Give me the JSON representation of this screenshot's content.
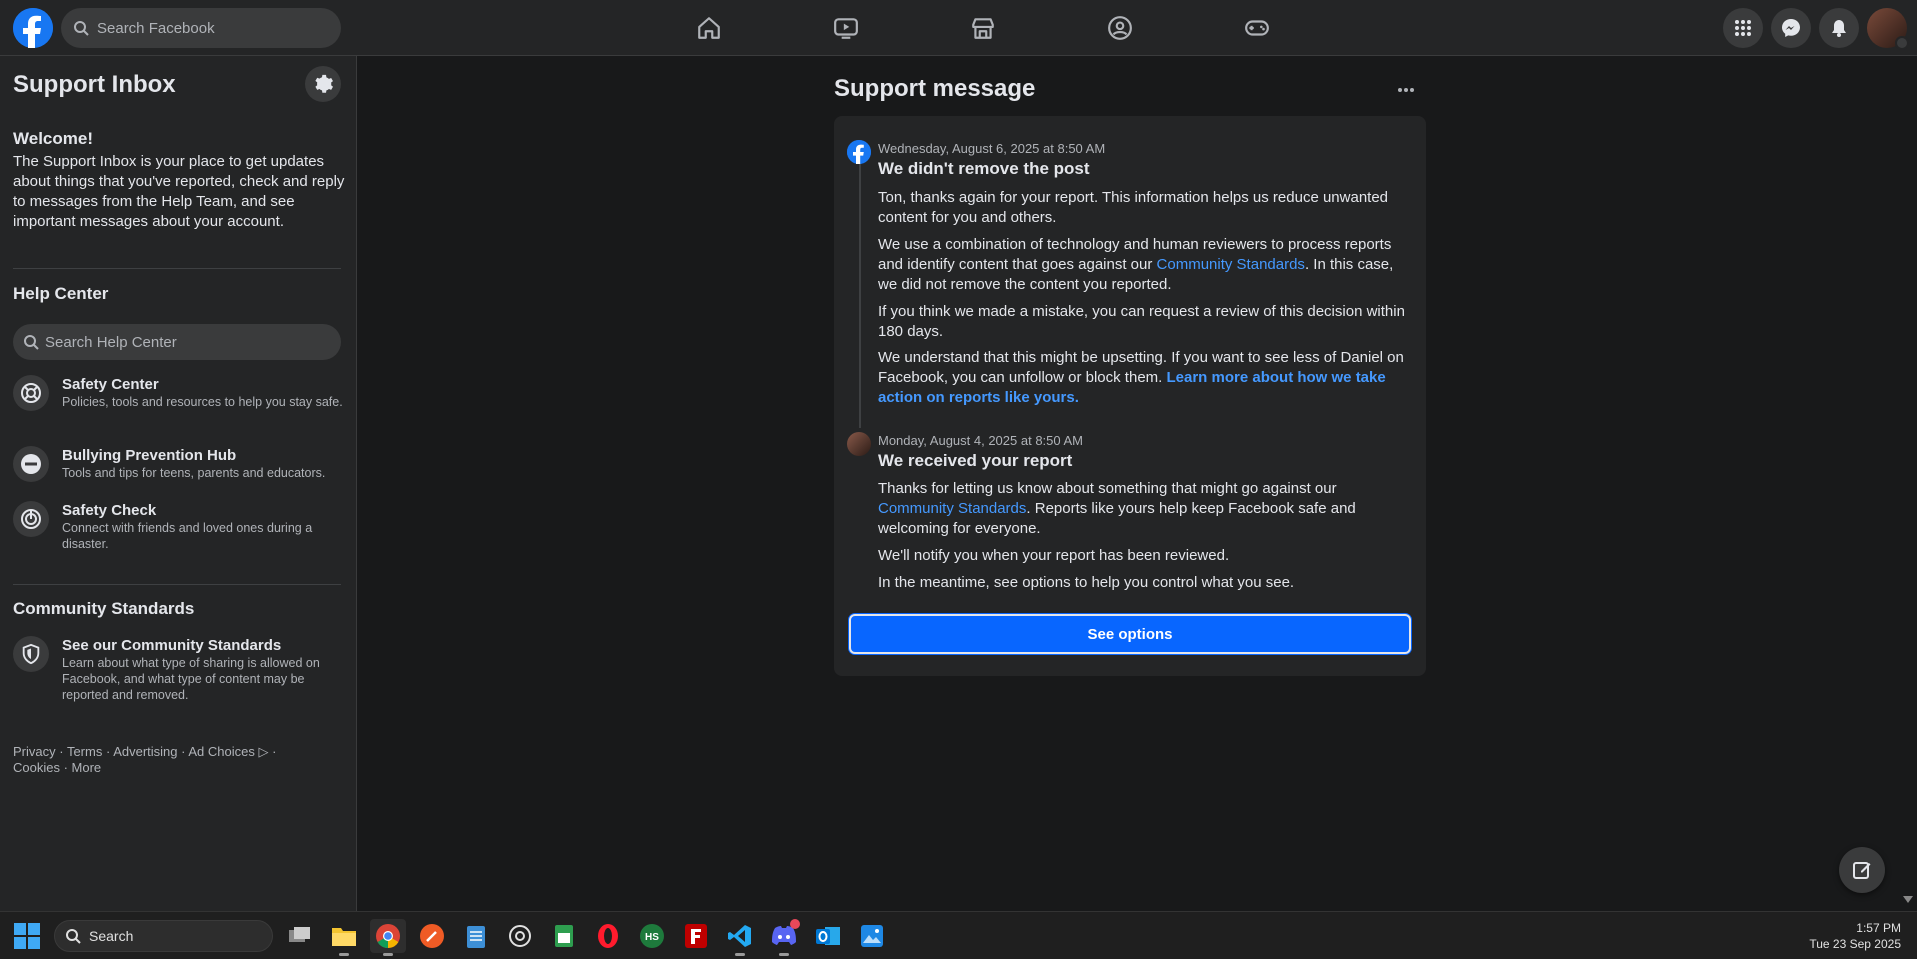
{
  "topbar": {
    "search_placeholder": "Search Facebook",
    "nav_items": [
      "home",
      "watch",
      "marketplace",
      "groups",
      "gaming"
    ]
  },
  "sidebar": {
    "title": "Support Inbox",
    "welcome_heading": "Welcome!",
    "welcome_text": "The Support Inbox is your place to get updates about things that you've reported, check and reply to messages from the Help Team, and see important messages about your account.",
    "help_center_heading": "Help Center",
    "help_search_placeholder": "Search Help Center",
    "help_items": [
      {
        "title": "Safety Center",
        "desc": "Policies, tools and resources to help you stay safe.",
        "icon": "lifebuoy-icon"
      },
      {
        "title": "Bullying Prevention Hub",
        "desc": "Tools and tips for teens, parents and educators.",
        "icon": "no-entry-icon"
      },
      {
        "title": "Safety Check",
        "desc": "Connect with friends and loved ones during a disaster.",
        "icon": "safety-check-icon"
      }
    ],
    "community_heading": "Community Standards",
    "community_item": {
      "title": "See our Community Standards",
      "desc": "Learn about what type of sharing is allowed on Facebook, and what type of content may be reported and removed."
    },
    "footer": {
      "privacy": "Privacy",
      "terms": "Terms",
      "advertising": "Advertising",
      "ad_choices": "Ad Choices",
      "cookies": "Cookies",
      "more": "More"
    }
  },
  "main": {
    "title": "Support message",
    "messages": [
      {
        "date": "Wednesday, August 6, 2025 at 8:50 AM",
        "title": "We didn't remove the post",
        "p1": "Ton, thanks again for your report. This information helps us reduce unwanted content for you and others.",
        "p2_before": "We use a combination of technology and human reviewers to process reports and identify content that goes against our ",
        "p2_link": "Community Standards",
        "p2_after": ". In this case, we did not remove the content you reported.",
        "p3": "If you think we made a mistake, you can request a review of this decision within 180 days.",
        "p4_before": "We understand that this might be upsetting. If you want to see less of Daniel on Facebook, you can unfollow or block them. ",
        "p4_link": "Learn more about how we take action on reports like yours."
      },
      {
        "date": "Monday, August 4, 2025 at 8:50 AM",
        "title": "We received your report",
        "p1_before": "Thanks for letting us know about something that might go against our ",
        "p1_link": "Community Standards",
        "p1_after": ". Reports like yours help keep Facebook safe and welcoming for everyone.",
        "p2": "We'll notify you when your report has been reviewed.",
        "p3": "In the meantime, see options to help you control what you see."
      }
    ],
    "see_options_label": "See options"
  },
  "taskbar": {
    "search_label": "Search",
    "time": "1:57 PM",
    "date": "Tue 23 Sep 2025"
  },
  "colors": {
    "brand": "#1877f2",
    "link": "#4599ff",
    "button": "#0866ff",
    "background": "#18191a",
    "surface": "#242526"
  }
}
